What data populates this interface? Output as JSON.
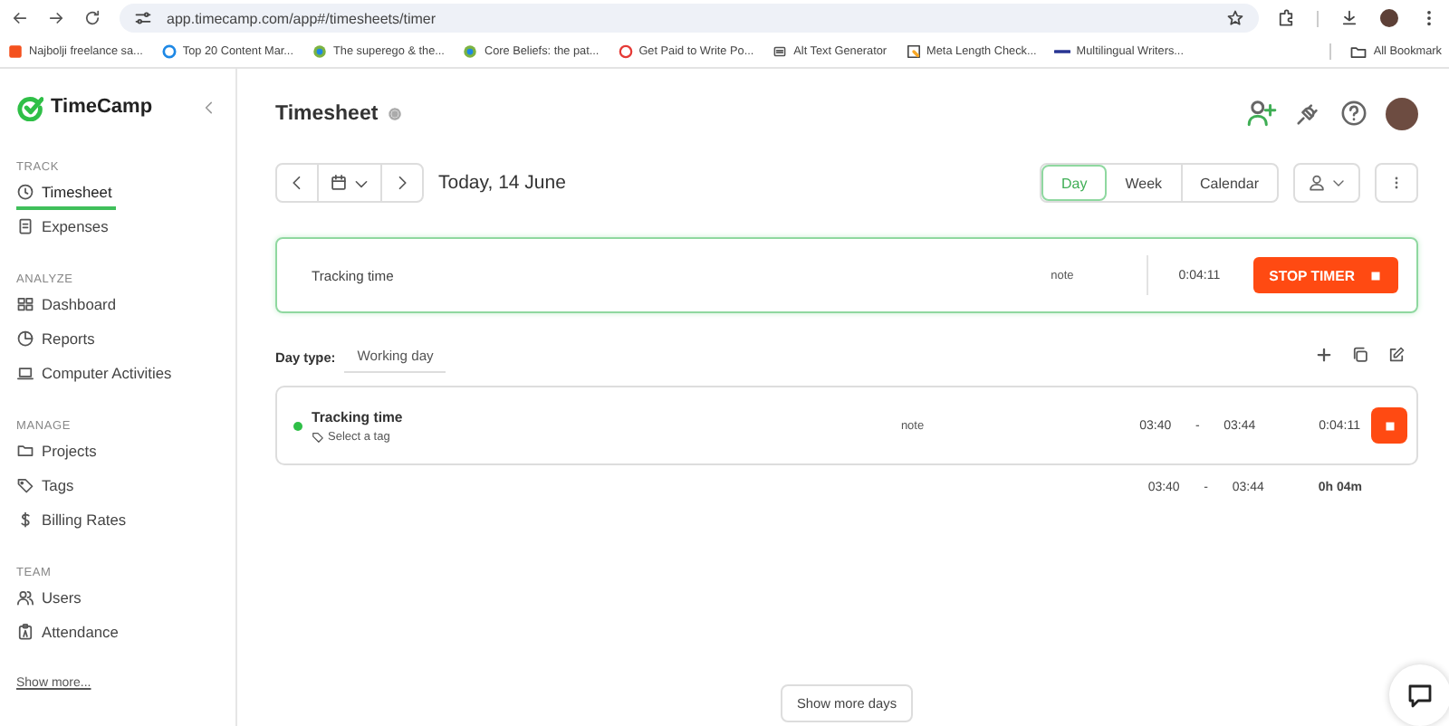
{
  "browser": {
    "url": "app.timecamp.com/app#/timesheets/timer",
    "bookmarks": [
      "Najbolji freelance sa...",
      "Top 20 Content Mar...",
      "The superego & the...",
      "Core Beliefs: the pat...",
      "Get Paid to Write Po...",
      "Alt Text Generator",
      "Meta Length Check...",
      "Multilingual Writers..."
    ],
    "all_bookmarks": "All Bookmark"
  },
  "sidebar": {
    "logo": "TimeCamp",
    "sections": [
      {
        "heading": "TRACK",
        "items": [
          {
            "label": "Timesheet",
            "selected": true
          },
          {
            "label": "Expenses",
            "selected": false
          }
        ]
      },
      {
        "heading": "ANALYZE",
        "items": [
          {
            "label": "Dashboard",
            "selected": false
          },
          {
            "label": "Reports",
            "selected": false
          },
          {
            "label": "Computer Activities",
            "selected": false
          }
        ]
      },
      {
        "heading": "MANAGE",
        "items": [
          {
            "label": "Projects",
            "selected": false
          },
          {
            "label": "Tags",
            "selected": false
          },
          {
            "label": "Billing Rates",
            "selected": false
          }
        ]
      },
      {
        "heading": "TEAM",
        "items": [
          {
            "label": "Users",
            "selected": false
          },
          {
            "label": "Attendance",
            "selected": false
          }
        ]
      }
    ],
    "show_more": "Show more..."
  },
  "page": {
    "title": "Timesheet",
    "date": "Today, 14 June",
    "views": [
      {
        "label": "Day",
        "selected": true
      },
      {
        "label": "Week",
        "selected": false
      },
      {
        "label": "Calendar",
        "selected": false
      }
    ]
  },
  "timer": {
    "task": "Tracking time",
    "note": "note",
    "duration": "0:04:11",
    "button": "STOP TIMER"
  },
  "day_type": {
    "label": "Day type:",
    "value": "Working day"
  },
  "entries": [
    {
      "task": "Tracking time",
      "tag": "Select a tag",
      "note": "note",
      "start": "03:40",
      "separator": "-",
      "end": "03:44",
      "duration": "0:04:11",
      "running": true
    }
  ],
  "totals": {
    "start": "03:40",
    "separator": "-",
    "end": "03:44",
    "duration": "0h 04m"
  },
  "show_more_days": "Show more days"
}
